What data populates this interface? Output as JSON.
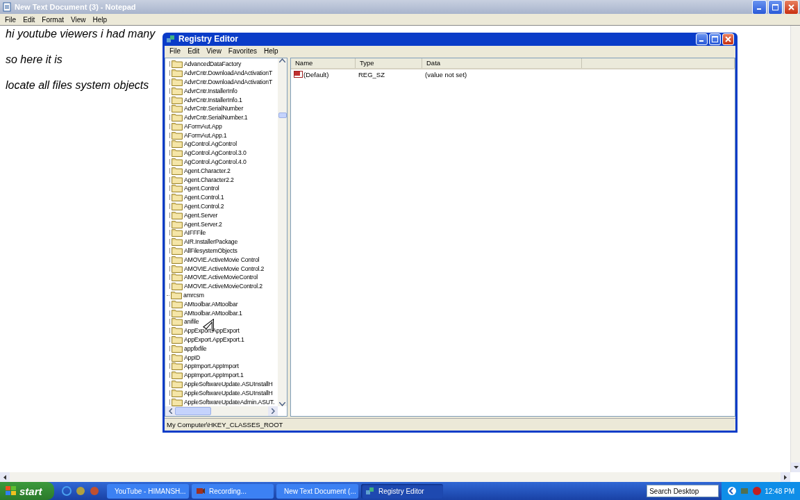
{
  "notepad": {
    "title": "New Text Document (3) - Notepad",
    "menu": [
      "File",
      "Edit",
      "Format",
      "View",
      "Help"
    ],
    "lines": [
      "hi youtube viewers i had many",
      "so here it is",
      "locate all files system objects"
    ]
  },
  "registry": {
    "title": "Registry Editor",
    "menu": [
      "File",
      "Edit",
      "View",
      "Favorites",
      "Help"
    ],
    "tree": [
      {
        "label": "AdvancedDataFactory",
        "has_children": true
      },
      {
        "label": "AdvrCntr.DownloadAndActivationT",
        "has_children": true
      },
      {
        "label": "AdvrCntr.DownloadAndActivationT",
        "has_children": true
      },
      {
        "label": "AdvrCntr.InstallerInfo",
        "has_children": true
      },
      {
        "label": "AdvrCntr.InstallerInfo.1",
        "has_children": true
      },
      {
        "label": "AdvrCntr.SerialNumber",
        "has_children": true
      },
      {
        "label": "AdvrCntr.SerialNumber.1",
        "has_children": true
      },
      {
        "label": "AFormAut.App",
        "has_children": true
      },
      {
        "label": "AFormAut.App.1",
        "has_children": true
      },
      {
        "label": "AgControl.AgControl",
        "has_children": true
      },
      {
        "label": "AgControl.AgControl.3.0",
        "has_children": true
      },
      {
        "label": "AgControl.AgControl.4.0",
        "has_children": true
      },
      {
        "label": "Agent.Character.2",
        "has_children": true
      },
      {
        "label": "Agent.Character2.2",
        "has_children": true
      },
      {
        "label": "Agent.Control",
        "has_children": true
      },
      {
        "label": "Agent.Control.1",
        "has_children": true
      },
      {
        "label": "Agent.Control.2",
        "has_children": true
      },
      {
        "label": "Agent.Server",
        "has_children": true
      },
      {
        "label": "Agent.Server.2",
        "has_children": true
      },
      {
        "label": "AIFFFile",
        "has_children": true
      },
      {
        "label": "AIR.InstallerPackage",
        "has_children": true
      },
      {
        "label": "AllFilesystemObjects",
        "has_children": true
      },
      {
        "label": "AMOVIE.ActiveMovie Control",
        "has_children": true
      },
      {
        "label": "AMOVIE.ActiveMovie Control.2",
        "has_children": true
      },
      {
        "label": "AMOVIE.ActiveMovieControl",
        "has_children": true
      },
      {
        "label": "AMOVIE.ActiveMovieControl.2",
        "has_children": true
      },
      {
        "label": "amrcsm",
        "has_children": false
      },
      {
        "label": "AMtoolbar.AMtoolbar",
        "has_children": true
      },
      {
        "label": "AMtoolbar.AMtoolbar.1",
        "has_children": true
      },
      {
        "label": "anifile",
        "has_children": true
      },
      {
        "label": "AppExport.AppExport",
        "has_children": true
      },
      {
        "label": "AppExport.AppExport.1",
        "has_children": true
      },
      {
        "label": "appfixfile",
        "has_children": true
      },
      {
        "label": "AppID",
        "has_children": true
      },
      {
        "label": "AppImport.AppImport",
        "has_children": true
      },
      {
        "label": "AppImport.AppImport.1",
        "has_children": true
      },
      {
        "label": "AppleSoftwareUpdate.ASUInstallH",
        "has_children": true
      },
      {
        "label": "AppleSoftwareUpdate.ASUInstallH",
        "has_children": true
      },
      {
        "label": "AppleSoftwareUpdateAdmin.ASUT.",
        "has_children": true
      }
    ],
    "columns": [
      "Name",
      "Type",
      "Data"
    ],
    "values": [
      {
        "name": "(Default)",
        "type": "REG_SZ",
        "data": "(value not set)"
      }
    ],
    "status_bar": "My Computer\\HKEY_CLASSES_ROOT"
  },
  "taskbar": {
    "start": "start",
    "tasks": [
      {
        "label": "YouTube - HIMANSH...",
        "kind": "browser",
        "selected": false
      },
      {
        "label": "Recording...",
        "kind": "recorder",
        "selected": false
      },
      {
        "label": "New Text Document (...",
        "kind": "notepad",
        "selected": false
      },
      {
        "label": "Registry Editor",
        "kind": "regedit",
        "selected": true
      }
    ],
    "search": {
      "placeholder": "Search Desktop"
    },
    "clock": "12:48 PM"
  }
}
